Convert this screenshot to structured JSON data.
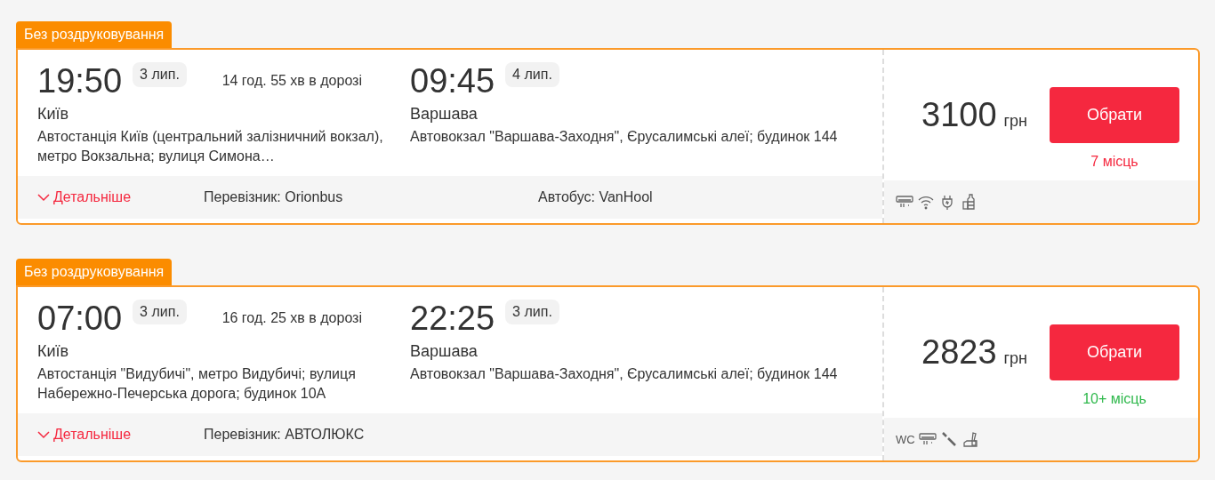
{
  "trips": [
    {
      "tag": "Без роздруковування",
      "depart": {
        "time": "19:50",
        "date": "3 лип.",
        "city": "Київ",
        "station": "Автостанція Київ (центральний залізничний вокзал), метро Вокзальна; вулиця Симона…"
      },
      "duration": "14 год. 55 хв в дорозі",
      "arrive": {
        "time": "09:45",
        "date": "4 лип.",
        "city": "Варшава",
        "station": "Автовокзал \"Варшава-Заходня\", Єрусалимські алеї; будинок 144"
      },
      "price": "3100",
      "currency": "грн",
      "button": "Обрати",
      "seats": {
        "text": "7 місць",
        "color": "#f5283f"
      },
      "details": "Детальніше",
      "carrier": "Перевізник: Orionbus",
      "bus": "Автобус: VanHool",
      "amenities": [
        {
          "kind": "ac"
        },
        {
          "kind": "wifi"
        },
        {
          "kind": "plug"
        },
        {
          "kind": "bottle"
        }
      ]
    },
    {
      "tag": "Без роздруковування",
      "depart": {
        "time": "07:00",
        "date": "3 лип.",
        "city": "Київ",
        "station": "Автостанція \"Видубичі\", метро Видубичі; вулиця Набережно-Печерська дорога; будинок 10А"
      },
      "duration": "16 год. 25 хв в дорозі",
      "arrive": {
        "time": "22:25",
        "date": "3 лип.",
        "city": "Варшава",
        "station": "Автовокзал \"Варшава-Заходня\", Єрусалимські алеї; будинок 144"
      },
      "price": "2823",
      "currency": "грн",
      "button": "Обрати",
      "seats": {
        "text": "10+ місць",
        "color": "#2eb84b"
      },
      "details": "Детальніше",
      "carrier": "Перевізник: АВТОЛЮКС",
      "amenities": [
        {
          "kind": "text",
          "label": "WC"
        },
        {
          "kind": "ac"
        },
        {
          "kind": "cable"
        },
        {
          "kind": "seat"
        }
      ]
    }
  ]
}
